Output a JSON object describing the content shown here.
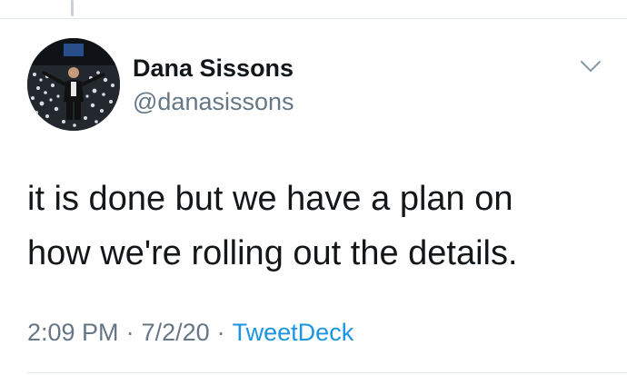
{
  "author": {
    "display_name": "Dana Sissons",
    "handle": "@danasissons",
    "avatar_icon": "profile-photo"
  },
  "tweet": {
    "lines": [
      "it is done but we have a plan on",
      "how we're rolling out the details."
    ]
  },
  "meta": {
    "time": "2:09 PM",
    "separator": "·",
    "date": "7/2/20",
    "source": "TweetDeck"
  },
  "colors": {
    "text": "#14171a",
    "secondary": "#657786",
    "link": "#1b95e0",
    "divider": "#e1e8ed"
  },
  "icons": {
    "menu": "chevron-down-icon"
  }
}
